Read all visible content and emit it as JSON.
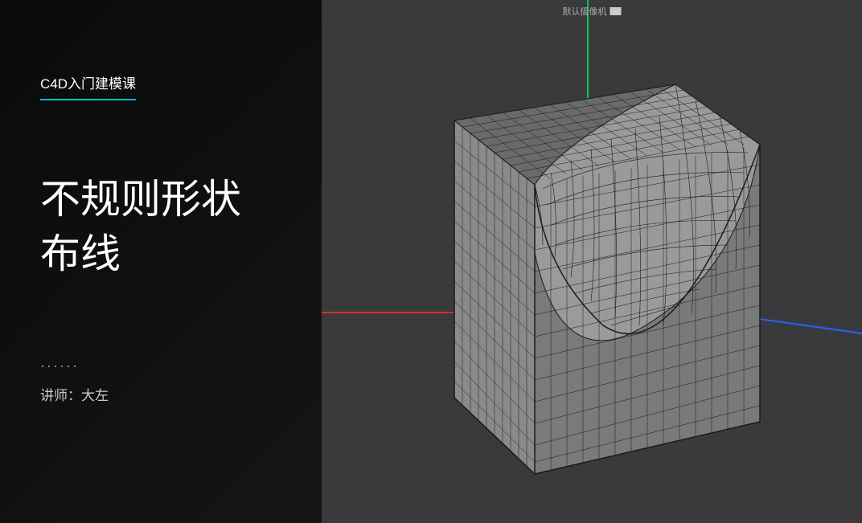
{
  "course": {
    "label": "C4D入门建模课"
  },
  "title": {
    "line1": "不规则形状",
    "line2": "布线"
  },
  "dots": "······",
  "instructor": {
    "label": "讲师：大左"
  },
  "viewport": {
    "camera_label": "默认摄像机"
  },
  "colors": {
    "accent": "#00bfc4",
    "axis_x": "#d32f2f",
    "axis_y": "#00c853",
    "axis_z": "#2962ff"
  }
}
